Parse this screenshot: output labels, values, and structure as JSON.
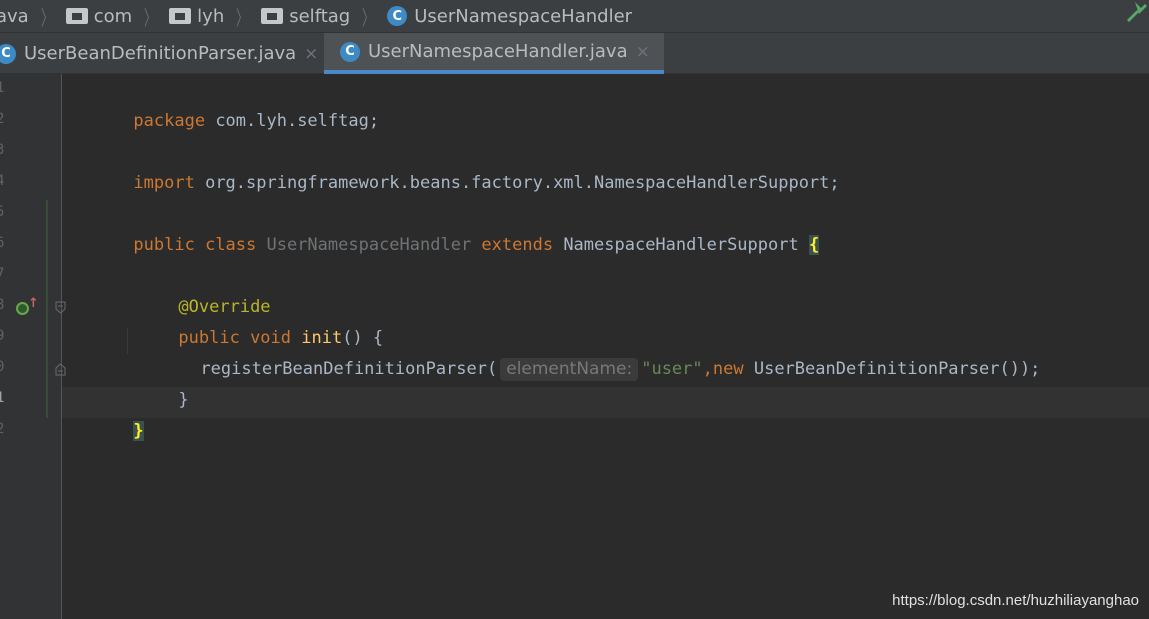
{
  "breadcrumb": {
    "items": [
      {
        "label": "ava",
        "icon": "none"
      },
      {
        "label": "com",
        "icon": "folder-icon"
      },
      {
        "label": "lyh",
        "icon": "folder-icon"
      },
      {
        "label": "selftag",
        "icon": "folder-icon"
      },
      {
        "label": "UserNamespaceHandler",
        "icon": "class-icon"
      }
    ],
    "separator": "〉"
  },
  "tabs": [
    {
      "label": "UserBeanDefinitionParser.java",
      "close": "×",
      "icon_letter": "C",
      "active": false
    },
    {
      "label": "UserNamespaceHandler.java",
      "close": "×",
      "icon_letter": "C",
      "active": true
    }
  ],
  "editor": {
    "line_numbers": [
      "1",
      "2",
      "3",
      "4",
      "5",
      "6",
      "7",
      "8",
      "9",
      "0",
      "1",
      "2"
    ],
    "lines": {
      "l1": {
        "kw": "package",
        "rest": " com.lyh.selftag;"
      },
      "l3": {
        "kw": "import",
        "rest": " org.springframework.beans.factory.xml.NamespaceHandlerSupport;"
      },
      "l5": {
        "kw1": "public class ",
        "cls": "UserNamespaceHandler",
        "kw2": " extends ",
        "rest": "NamespaceHandlerSupport ",
        "brace": "{"
      },
      "l7": {
        "anno": "@Override"
      },
      "l8": {
        "kw": "public void ",
        "fn": "init",
        "rest": "() {"
      },
      "l9": {
        "call": "registerBeanDefinitionParser(",
        "hint": "elementName:",
        "str": "\"user\"",
        "comma": ",",
        "kw": "new ",
        "rest": "UserBeanDefinitionParser());"
      },
      "l10": {
        "text": "}"
      },
      "l11": {
        "brace": "}"
      }
    }
  },
  "watermark": "https://blog.csdn.net/huzhiliayanghao",
  "colors": {
    "keyword": "#cc7832",
    "string": "#6a8759",
    "annotation": "#bbb529",
    "function": "#ffc66d",
    "accent": "#4a88c7",
    "class_icon": "#3d8ac4"
  }
}
